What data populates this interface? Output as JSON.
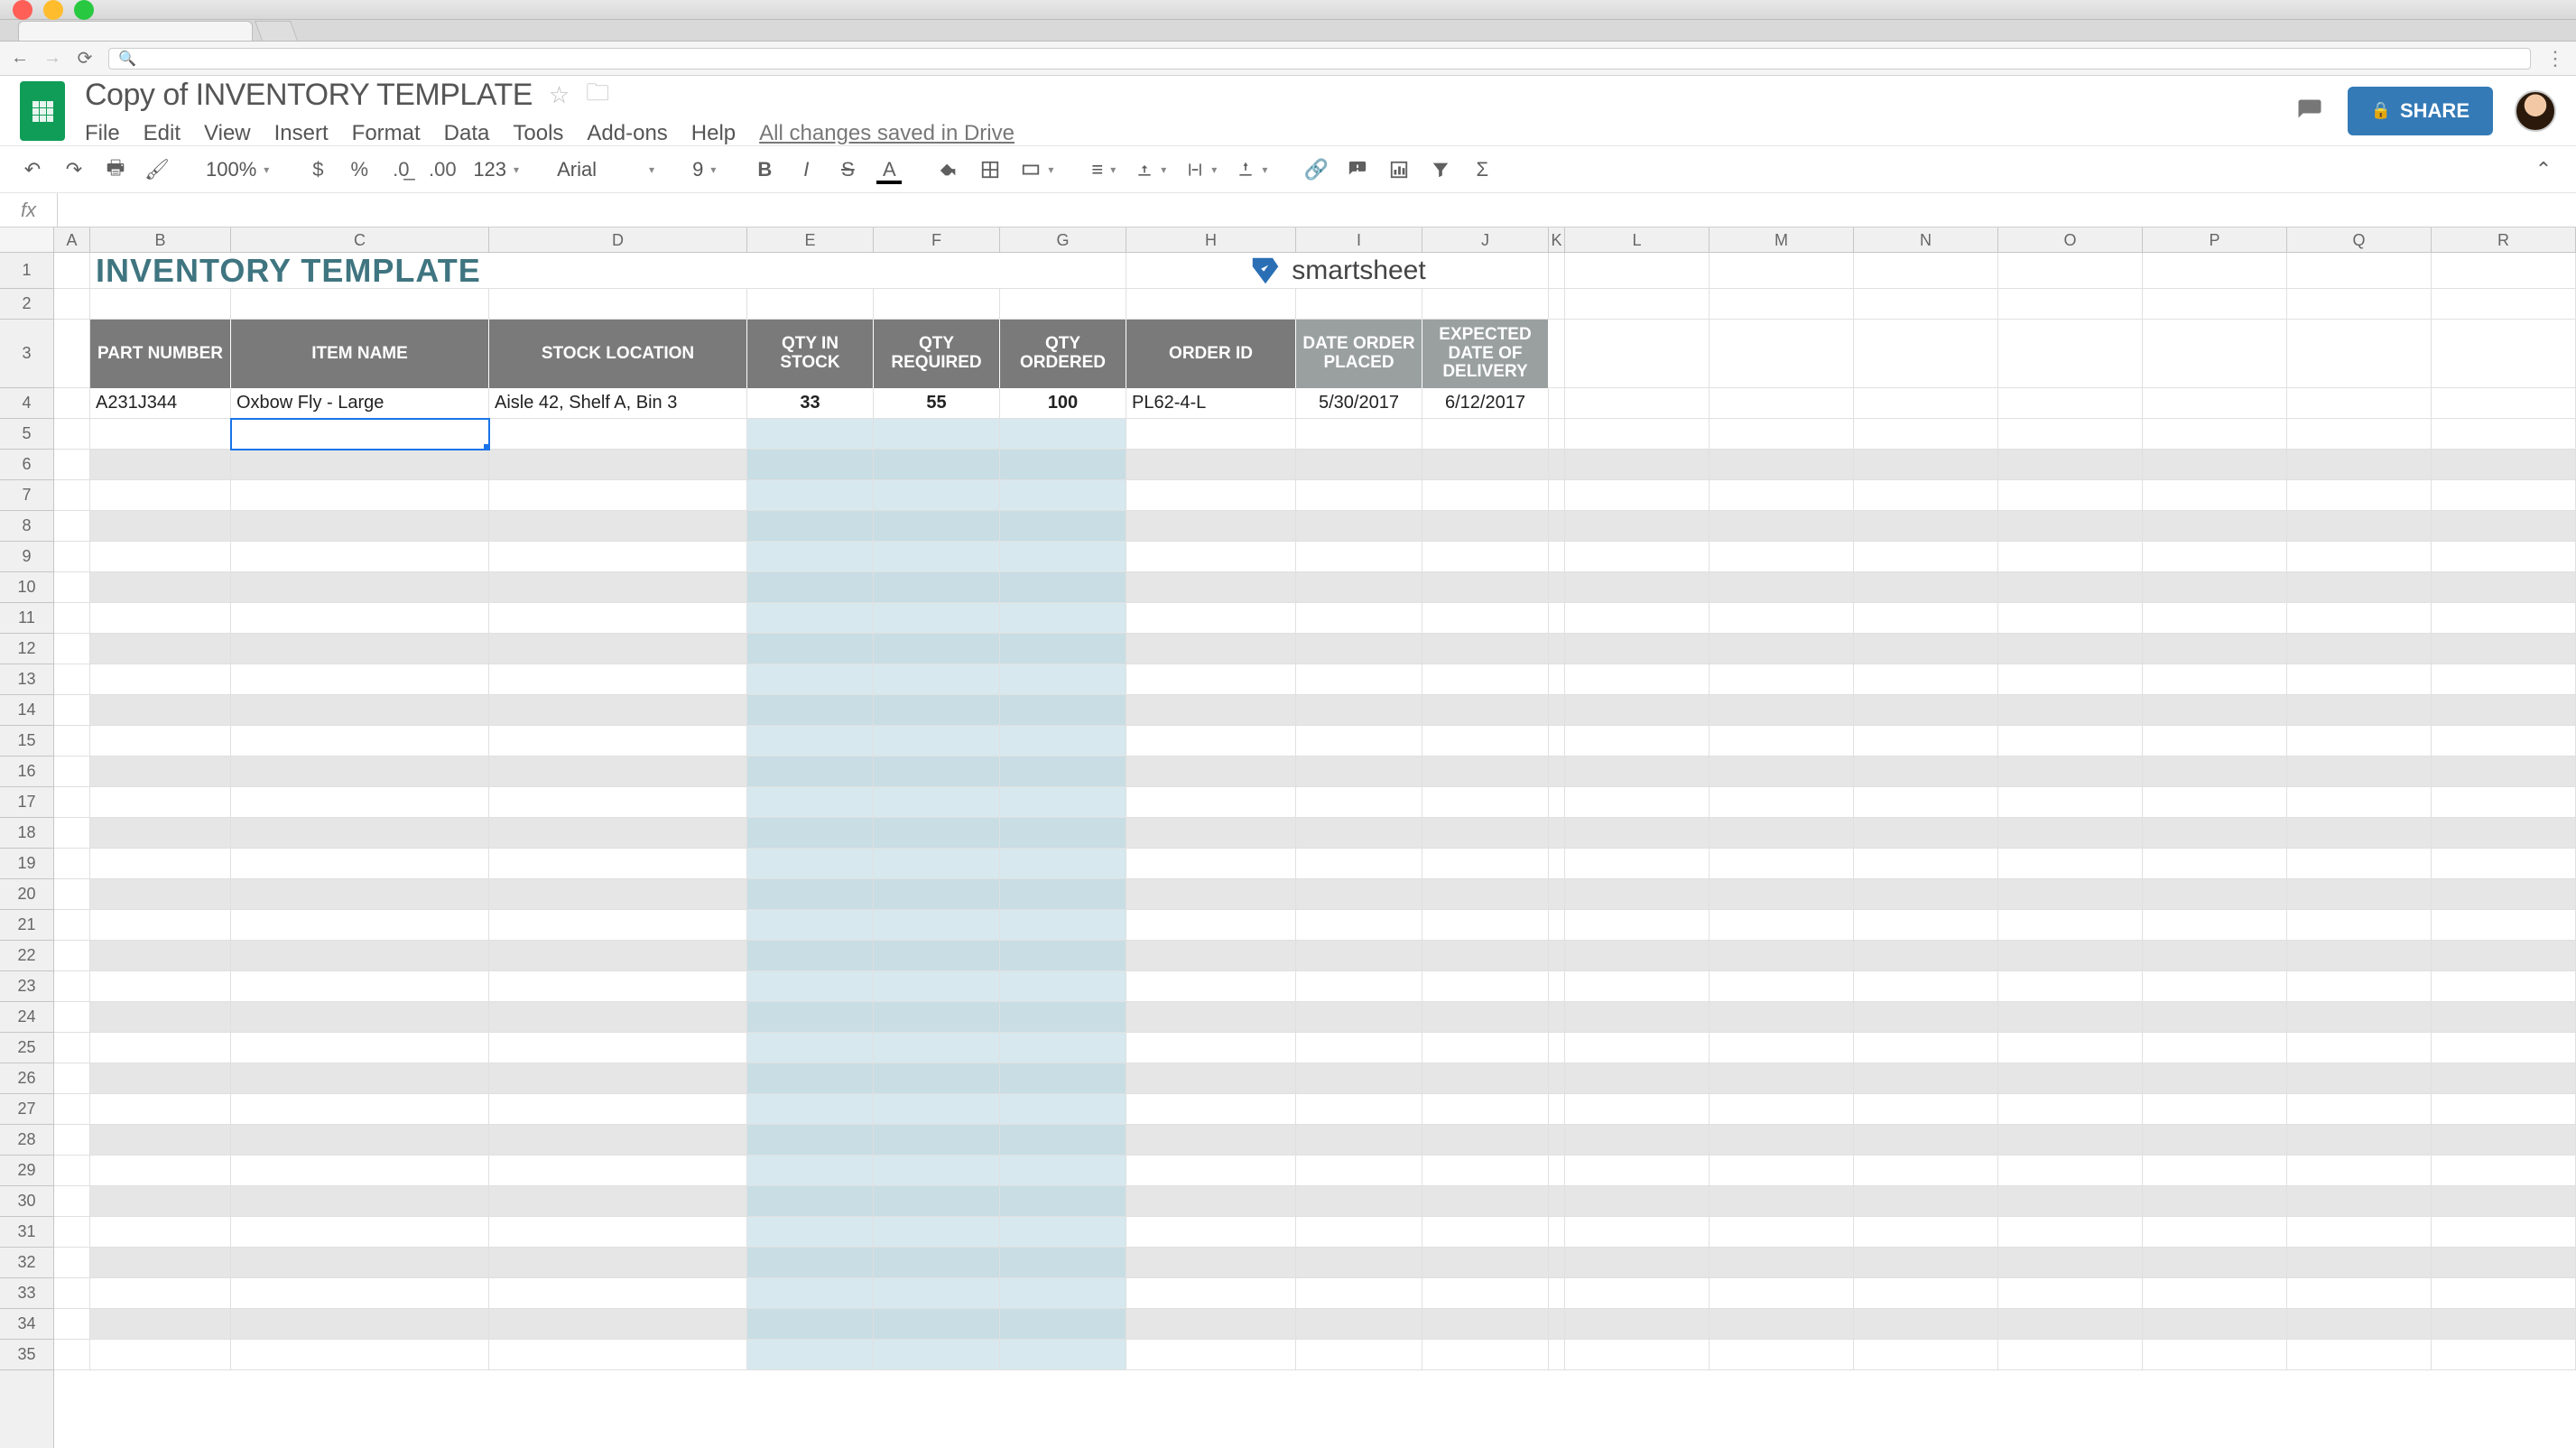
{
  "window": {
    "os": "macOS"
  },
  "browser": {
    "url_placeholder": ""
  },
  "doc": {
    "title": "Copy of INVENTORY TEMPLATE",
    "menus": [
      "File",
      "Edit",
      "View",
      "Insert",
      "Format",
      "Data",
      "Tools",
      "Add-ons",
      "Help"
    ],
    "save_status": "All changes saved in Drive",
    "share_label": "SHARE"
  },
  "toolbar": {
    "zoom": "100%",
    "font": "Arial",
    "font_size": "9",
    "number_format": "123"
  },
  "formula_bar": {
    "label": "fx",
    "value": ""
  },
  "columns": [
    "A",
    "B",
    "C",
    "D",
    "E",
    "F",
    "G",
    "H",
    "I",
    "J",
    "K",
    "L",
    "M",
    "N",
    "O",
    "P",
    "Q",
    "R"
  ],
  "rows_count": 35,
  "selected_cell": "C5",
  "sheet": {
    "title": "INVENTORY TEMPLATE",
    "brand": "smartsheet",
    "headers": {
      "part_number": "PART NUMBER",
      "item_name": "ITEM NAME",
      "stock_location": "STOCK LOCATION",
      "qty_in_stock": "QTY IN STOCK",
      "qty_required": "QTY REQUIRED",
      "qty_ordered": "QTY ORDERED",
      "order_id": "ORDER ID",
      "date_order_placed": "DATE ORDER PLACED",
      "expected_delivery": "EXPECTED DATE OF DELIVERY"
    },
    "data_rows": [
      {
        "part_number": "A231J344",
        "item_name": "Oxbow Fly - Large",
        "stock_location": "Aisle 42, Shelf A, Bin 3",
        "qty_in_stock": "33",
        "qty_required": "55",
        "qty_ordered": "100",
        "order_id": "PL62-4-L",
        "date_order_placed": "5/30/2017",
        "expected_delivery": "6/12/2017"
      }
    ]
  }
}
